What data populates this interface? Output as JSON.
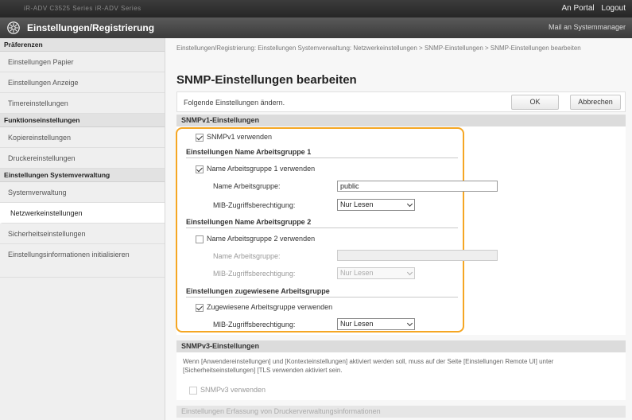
{
  "topbar": {
    "device": "iR-ADV C3525 Series  iR-ADV Series",
    "portal_label": "An Portal",
    "logout_label": "Logout"
  },
  "header": {
    "title": "Einstellungen/Registrierung",
    "mail_label": "Mail an Systemmanager"
  },
  "sidebar": {
    "groups": [
      {
        "title": "Präferenzen",
        "items": [
          "Einstellungen Papier",
          "Einstellungen Anzeige",
          "Timereinstellungen"
        ]
      },
      {
        "title": "Funktionseinstellungen",
        "items": [
          "Kopiereinstellungen",
          "Druckereinstellungen"
        ]
      },
      {
        "title": "Einstellungen Systemverwaltung",
        "items": [
          "Systemverwaltung",
          "Netzwerkeinstellungen",
          "Sicherheitseinstellungen",
          "Einstellungsinformationen initialisieren"
        ]
      }
    ],
    "active": "Netzwerkeinstellungen"
  },
  "main": {
    "breadcrumb": "Einstellungen/Registrierung: Einstellungen Systemverwaltung: Netzwerkeinstellungen > SNMP-Einstellungen > SNMP-Einstellungen bearbeiten",
    "title": "SNMP-Einstellungen bearbeiten",
    "description": "Folgende Einstellungen ändern.",
    "ok_label": "OK",
    "cancel_label": "Abbrechen",
    "v1": {
      "heading": "SNMPv1-Einstellungen",
      "use_v1": "SNMPv1 verwenden",
      "group1_heading": "Einstellungen Name Arbeitsgruppe 1",
      "group1_use": "Name Arbeitsgruppe 1 verwenden",
      "group1_name_label": "Name Arbeitsgruppe:",
      "group1_name_value": "public",
      "group1_mib_label": "MIB-Zugriffsberechtigung:",
      "group1_mib_value": "Nur Lesen",
      "group2_heading": "Einstellungen Name Arbeitsgruppe 2",
      "group2_use": "Name Arbeitsgruppe 2 verwenden",
      "group2_name_label": "Name Arbeitsgruppe:",
      "group2_mib_label": "MIB-Zugriffsberechtigung:",
      "group2_mib_value": "Nur Lesen",
      "assigned_heading": "Einstellungen zugewiesene Arbeitsgruppe",
      "assigned_use": "Zugewiesene Arbeitsgruppe verwenden",
      "assigned_mib_label": "MIB-Zugriffsberechtigung:",
      "assigned_mib_value": "Nur Lesen"
    },
    "v3": {
      "heading": "SNMPv3-Einstellungen",
      "note": "Wenn [Anwendereinstellungen] und [Kontexteinstellungen] aktiviert werden soll, muss auf der Seite [Einstellungen Remote UI] unter [Sicherheitseinstellungen] [TLS verwenden aktiviert sein.",
      "use_v3": "SNMPv3 verwenden"
    },
    "next_heading": "Einstellungen Erfassung von Druckerverwaltungsinformationen"
  },
  "colors": {
    "highlight": "#f5a623",
    "header": "#3a3a3a"
  }
}
